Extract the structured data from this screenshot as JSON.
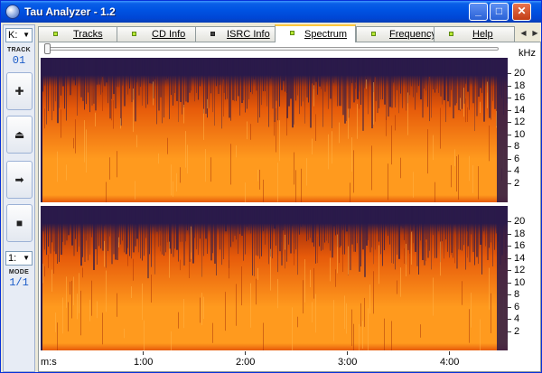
{
  "window": {
    "title": "Tau Analyzer - 1.2",
    "controls": {
      "minimize": "_",
      "maximize": "□",
      "close": "✕"
    }
  },
  "sidebar": {
    "drive": "K:",
    "track_label": "TRACK",
    "track_number": "01",
    "buttons": [
      {
        "name": "add",
        "icon": "plus-icon",
        "glyph": "✚"
      },
      {
        "name": "eject",
        "icon": "eject-icon",
        "glyph": "⏏"
      },
      {
        "name": "forward",
        "icon": "arrow-right-icon",
        "glyph": "➡"
      },
      {
        "name": "stop",
        "icon": "stop-icon",
        "glyph": "■"
      }
    ],
    "mode_select": "1:",
    "mode_label": "MODE",
    "mode_value": "1/1"
  },
  "tabs": [
    {
      "label": "Tracks",
      "led": "on",
      "active": false
    },
    {
      "label": "CD Info",
      "led": "on",
      "active": false
    },
    {
      "label": "ISRC Info",
      "led": "off",
      "active": false
    },
    {
      "label": "Spectrum",
      "led": "on",
      "active": true
    },
    {
      "label": "Frequency",
      "led": "on",
      "active": false
    },
    {
      "label": "Help",
      "led": "on",
      "active": false
    }
  ],
  "spectrum": {
    "unit_label": "kHz",
    "freq_ticks": [
      "20",
      "18",
      "16",
      "14",
      "12",
      "10",
      "8",
      "6",
      "4",
      "2"
    ],
    "time_unit": "m:s",
    "time_ticks": [
      "1:00",
      "2:00",
      "3:00",
      "4:00"
    ],
    "colors": {
      "dark": "#2A1A4A",
      "hot": "#FF9A1E",
      "mid": "#E65A0A",
      "low": "#B83A0A"
    }
  }
}
